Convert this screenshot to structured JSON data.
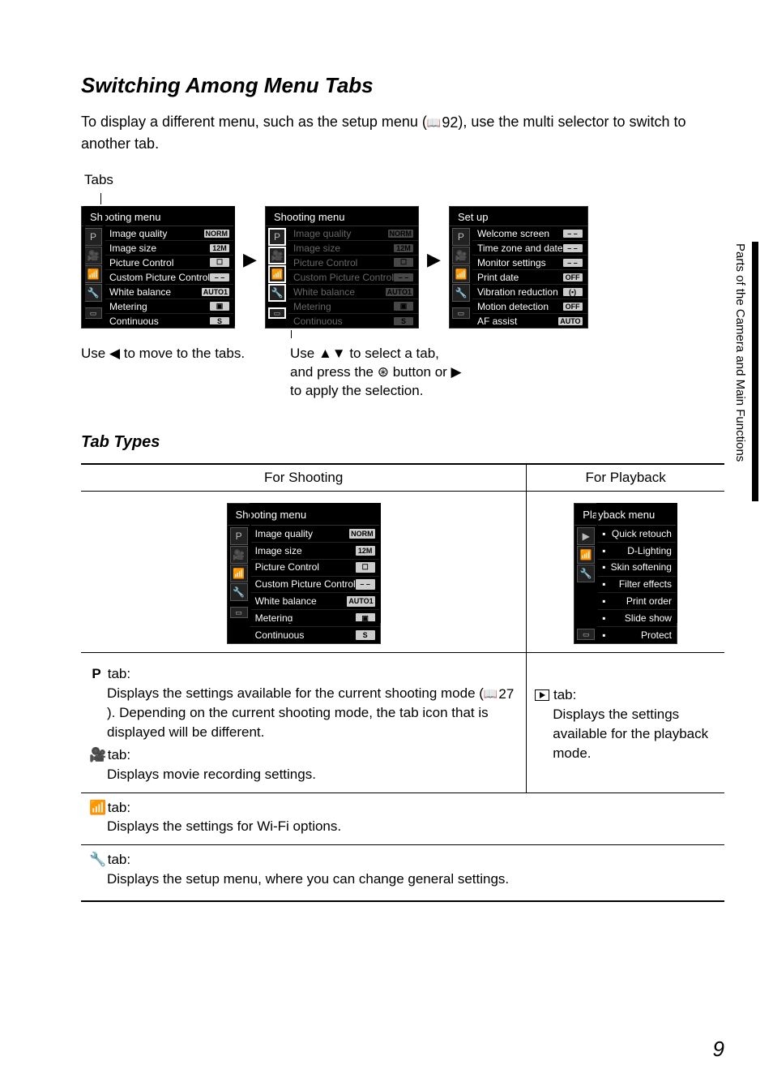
{
  "heading": "Switching Among Menu Tabs",
  "intro_a": "To display a different menu, such as the setup menu (",
  "intro_ref": "92",
  "intro_b": "), use the multi selector to switch to another tab.",
  "tabs_label": "Tabs",
  "menu_shooting_title": "Shooting menu",
  "menu_setup_title": "Set up",
  "shooting_items": [
    {
      "label": "Image quality",
      "val": "NORM"
    },
    {
      "label": "Image size",
      "val": "12M"
    },
    {
      "label": "Picture Control",
      "val": "☐"
    },
    {
      "label": "Custom Picture Control",
      "val": "– –"
    },
    {
      "label": "White balance",
      "val": "AUTO1"
    },
    {
      "label": "Metering",
      "val": "▣"
    },
    {
      "label": "Continuous",
      "val": "S"
    }
  ],
  "setup_items": [
    {
      "label": "Welcome screen",
      "val": "– –"
    },
    {
      "label": "Time zone and date",
      "val": "– –"
    },
    {
      "label": "Monitor settings",
      "val": "– –"
    },
    {
      "label": "Print date",
      "val": "OFF"
    },
    {
      "label": "Vibration reduction",
      "val": "(▪)"
    },
    {
      "label": "Motion detection",
      "val": "OFF"
    },
    {
      "label": "AF assist",
      "val": "AUTO"
    }
  ],
  "playback_items": [
    {
      "label": "Quick retouch"
    },
    {
      "label": "D-Lighting"
    },
    {
      "label": "Skin softening"
    },
    {
      "label": "Filter effects"
    },
    {
      "label": "Print order"
    },
    {
      "label": "Slide show"
    },
    {
      "label": "Protect"
    }
  ],
  "cap1": "Use ◀ to move to the tabs.",
  "cap2_a": "Use ▲▼ to select a tab, and press the ",
  "cap2_b": " button or ▶ to apply the selection.",
  "ok_glyph": "⊛",
  "tab_types_heading": "Tab Types",
  "th_shoot": "For Shooting",
  "th_play": "For Playback",
  "playback_menu_title": "Playback menu",
  "p_tab_label": " tab:",
  "p_tab_desc_a": "Displays the settings available for the current shooting mode (",
  "p_tab_ref": "27",
  "p_tab_desc_b": ").",
  "p_tab_desc_c": "Depending on the current shooting mode, the tab icon that is displayed will be different.",
  "movie_tab_desc": "Displays movie recording settings.",
  "play_tab_desc": "Displays the settings available for the playback mode.",
  "wifi_tab_desc": "Displays the settings for Wi-Fi options.",
  "setup_tab_desc": "Displays the setup menu, where you can change general settings.",
  "side_text": "Parts of the Camera and Main Functions",
  "page_num": "9",
  "P_sym": "P"
}
